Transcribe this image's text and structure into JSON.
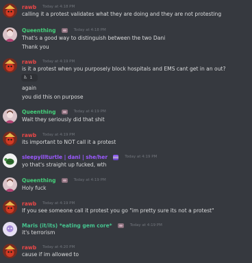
{
  "colors": {
    "background": "#36393f",
    "rawb": "#ec4848",
    "queenthing": "#44d07a",
    "sleepy": "#9b59ff",
    "maris": "#46c38f",
    "timestamp": "#72767d",
    "text": "#dcddde"
  },
  "messages": [
    {
      "author": "rawb",
      "author_color": "#ec4848",
      "timestamp": "Today at 4:18 PM",
      "avatar": "rawb-avatar",
      "lines": [
        "calling it a protest validates what they are doing and they are not protesting"
      ]
    },
    {
      "author": "Queenthing",
      "author_color": "#44d07a",
      "timestamp": "Today at 4:18 PM",
      "avatar": "queenthing-avatar",
      "lines": [
        "That's a good way to distinguish between the two Dani",
        "Thank you"
      ]
    },
    {
      "author": "rawb",
      "author_color": "#ec4848",
      "timestamp": "Today at 4:19 PM",
      "avatar": "rawb-avatar",
      "lines": [
        "is it a protest when you purposely block hospitals and EMS cant get in an out?"
      ],
      "reaction": {
        "emoji": "wheelchair-emoji",
        "glyph": "♿",
        "count": "1"
      },
      "lines_after": [
        "again",
        "you did this on purpose"
      ]
    },
    {
      "author": "Queenthing",
      "author_color": "#44d07a",
      "timestamp": "Today at 4:19 PM",
      "avatar": "queenthing-avatar",
      "lines": [
        "Wait they seriously did that shit"
      ]
    },
    {
      "author": "rawb",
      "author_color": "#ec4848",
      "timestamp": "Today at 4:19 PM",
      "avatar": "rawb-avatar",
      "lines": [
        "its important to NOT call it a protest"
      ]
    },
    {
      "author": "sleepyillturtle | dani | she/her",
      "author_color": "#9b59ff",
      "timestamp": "Today at 4:19 PM",
      "avatar": "sleepy-avatar",
      "lines": [
        "yo that's straight up fucked, wth"
      ]
    },
    {
      "author": "Queenthing",
      "author_color": "#44d07a",
      "timestamp": "Today at 4:19 PM",
      "avatar": "queenthing-avatar",
      "lines": [
        "Holy fuck"
      ]
    },
    {
      "author": "rawb",
      "author_color": "#ec4848",
      "timestamp": "Today at 4:19 PM",
      "avatar": "rawb-avatar",
      "lines": [
        "If you see someone call it protest you go \"im pretty sure its not a protest\""
      ]
    },
    {
      "author": "Maris (it/its) *eating gem core*",
      "author_color": "#46c38f",
      "timestamp": "Today at 4:19 PM",
      "avatar": "maris-avatar",
      "lines": [
        "it's terrorism"
      ]
    },
    {
      "author": "rawb",
      "author_color": "#ec4848",
      "timestamp": "Today at 4:20 PM",
      "avatar": "rawb-avatar",
      "lines": [
        "cause if im allowed to"
      ]
    }
  ]
}
